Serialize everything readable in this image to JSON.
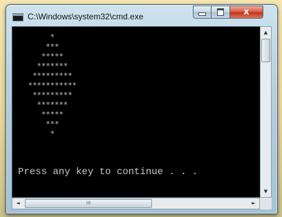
{
  "window": {
    "title": "C:\\Windows\\system32\\cmd.exe",
    "minimize_label": "",
    "maximize_label": "",
    "close_label": "x"
  },
  "console": {
    "pattern": "       *\n      ***\n     *****\n    *******\n   *********\n  ***********\n   *********\n    *******\n     *****\n      ***\n       *",
    "prompt": "Press any key to continue . . ."
  },
  "scrollbars": {
    "up_arrow": "▲",
    "down_arrow": "▼",
    "left_arrow": "◄",
    "right_arrow": "►",
    "h_thumb_grip": "III"
  },
  "icons": [
    "console-app-icon",
    "minimize-icon",
    "maximize-icon",
    "close-icon"
  ]
}
